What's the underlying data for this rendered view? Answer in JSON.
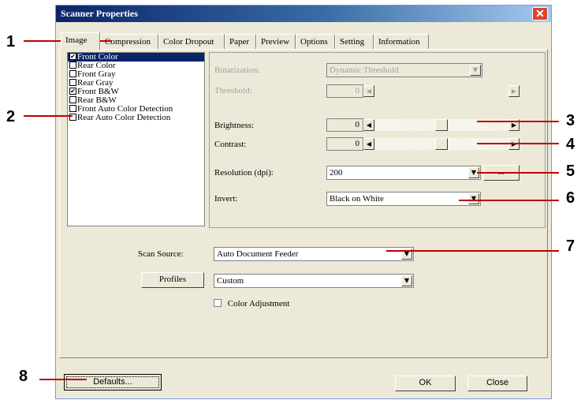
{
  "window": {
    "title": "Scanner Properties",
    "close_glyph": "✕"
  },
  "tabs": [
    {
      "label": "Image",
      "active": true
    },
    {
      "label": "Compression"
    },
    {
      "label": "Color Dropout"
    },
    {
      "label": "Paper"
    },
    {
      "label": "Preview"
    },
    {
      "label": "Options"
    },
    {
      "label": "Setting"
    },
    {
      "label": "Information"
    }
  ],
  "image_list": [
    {
      "label": "Front Color",
      "checked": true,
      "selected": true
    },
    {
      "label": "Rear Color",
      "checked": false
    },
    {
      "label": "Front Gray",
      "checked": false
    },
    {
      "label": "Rear Gray",
      "checked": false
    },
    {
      "label": "Front B&W",
      "checked": true
    },
    {
      "label": "Rear B&W",
      "checked": false
    },
    {
      "label": "Front Auto Color Detection",
      "checked": false
    },
    {
      "label": "Rear Auto Color Detection",
      "checked": false
    }
  ],
  "settings": {
    "binarization_label": "Binarization:",
    "binarization_value": "Dynamic Threshold",
    "threshold_label": "Threshold:",
    "threshold_value": "0",
    "brightness_label": "Brightness:",
    "brightness_value": "0",
    "contrast_label": "Contrast:",
    "contrast_value": "0",
    "resolution_label": "Resolution (dpi):",
    "resolution_value": "200",
    "resolution_more": "...",
    "invert_label": "Invert:",
    "invert_value": "Black on White"
  },
  "source": {
    "label": "Scan Source:",
    "value": "Auto Document Feeder",
    "profiles_button": "Profiles",
    "profiles_value": "Custom",
    "color_adjustment_label": "Color Adjustment",
    "color_adjustment_checked": false
  },
  "footer": {
    "defaults_button": "Defaults...",
    "ok_button": "OK",
    "close_button": "Close"
  },
  "callouts": [
    "1",
    "2",
    "3",
    "4",
    "5",
    "6",
    "7",
    "8"
  ],
  "colors": {
    "callout_line": "#c00000",
    "dialog_bg": "#ece9d8",
    "selection": "#0a246a"
  }
}
